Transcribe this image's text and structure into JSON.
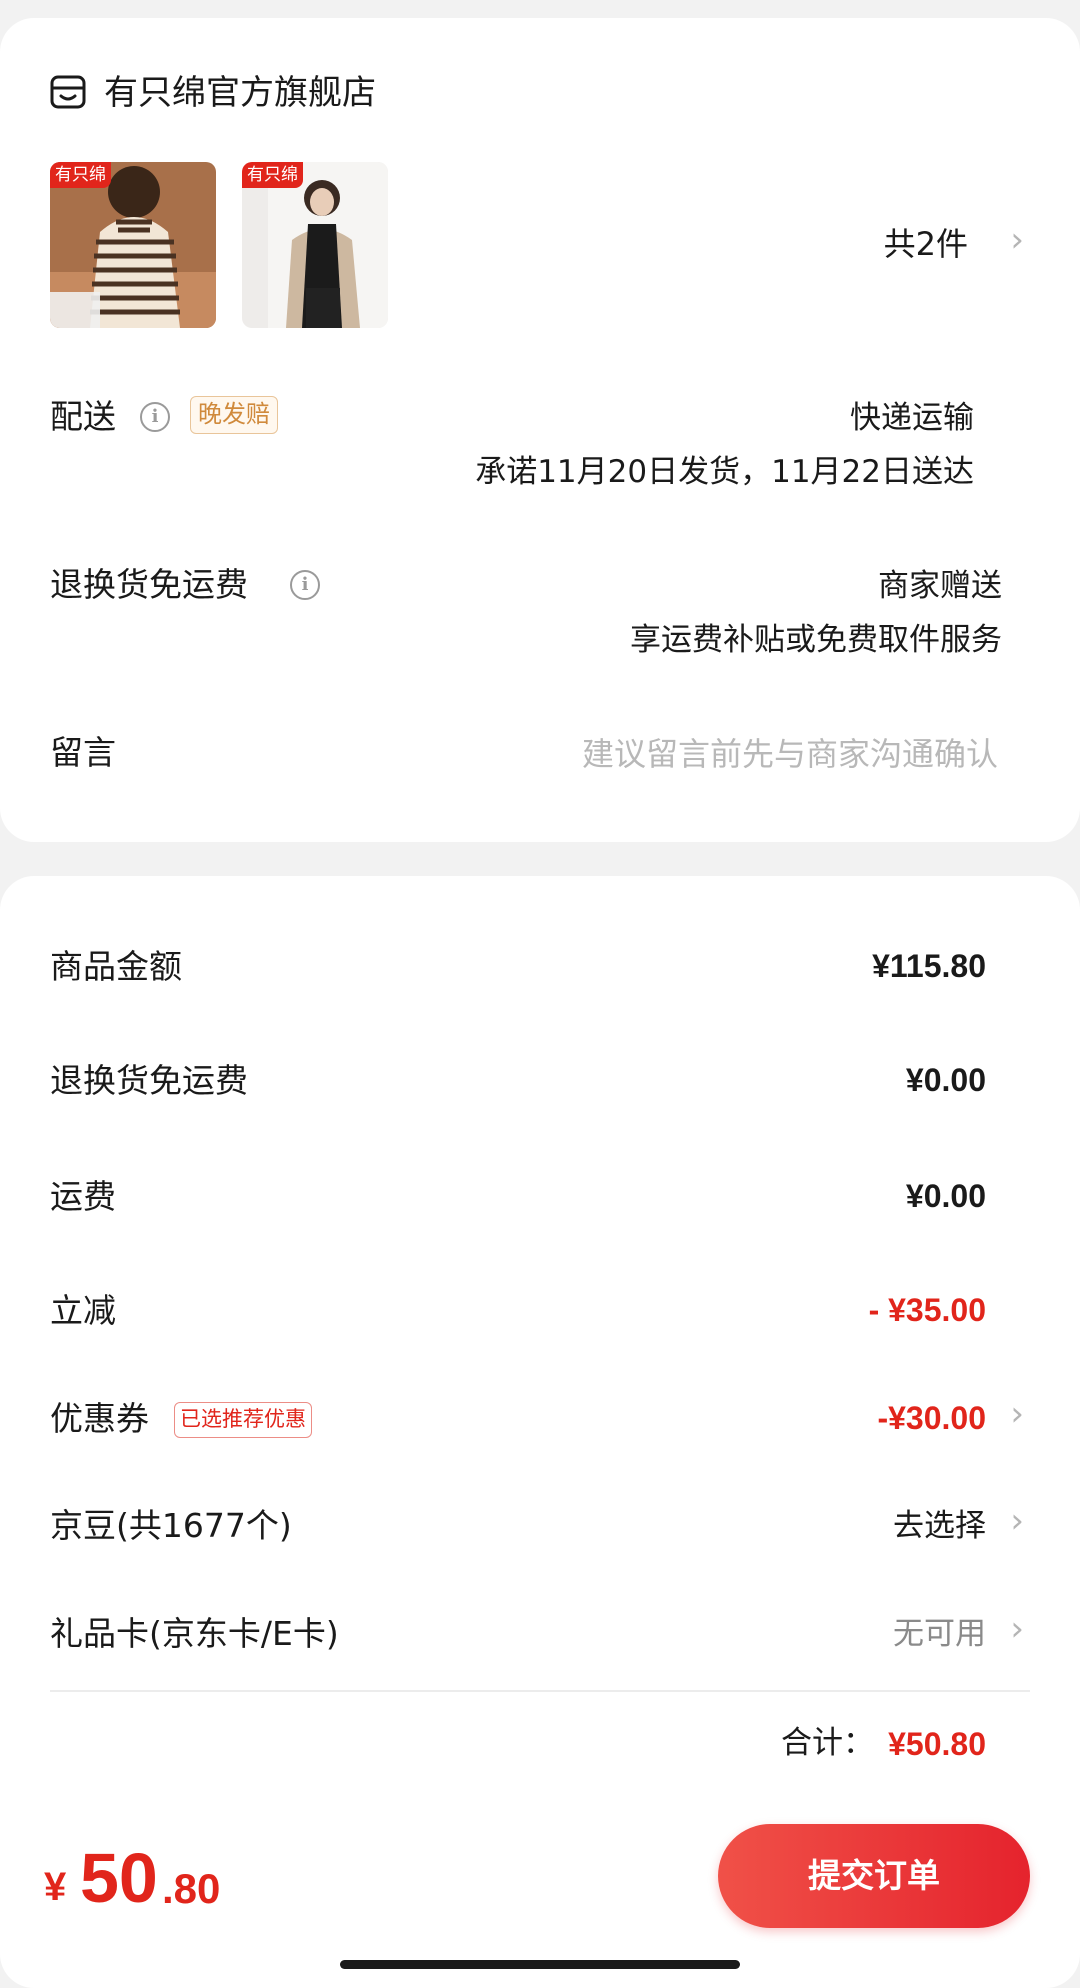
{
  "store": {
    "name": "有只绵官方旗舰店",
    "icon": "store-icon"
  },
  "items": {
    "thumbnail_tags": [
      "有只绵",
      "有只绵"
    ],
    "count_text": "共2件"
  },
  "delivery": {
    "label": "配送",
    "badge": "晚发赔",
    "method": "快递运输",
    "promise": "承诺11月20日发货，11月22日送达"
  },
  "return_shipping": {
    "label": "退换货免运费",
    "value": "商家赠送",
    "desc": "享运费补贴或免费取件服务"
  },
  "message": {
    "label": "留言",
    "placeholder": "建议留言前先与商家沟通确认"
  },
  "summary": {
    "goods_amount": {
      "label": "商品金额",
      "value": "¥115.80"
    },
    "return_fee": {
      "label": "退换货免运费",
      "value": "¥0.00"
    },
    "shipping": {
      "label": "运费",
      "value": "¥0.00"
    },
    "instant_discount": {
      "label": "立减",
      "value": "- ¥35.00"
    },
    "coupon": {
      "label": "优惠券",
      "badge": "已选推荐优惠",
      "value": "-¥30.00"
    },
    "jd_beans": {
      "label": "京豆(共1677个)",
      "value": "去选择"
    },
    "gift_card": {
      "label": "礼品卡(京东卡/E卡)",
      "value": "无可用"
    },
    "total_label": "合计：",
    "total_value": "¥50.80"
  },
  "footer": {
    "currency": "¥",
    "amount_int": "50",
    "amount_dec": ".80",
    "submit_label": "提交订单"
  },
  "colors": {
    "accent_red": "#e1251b",
    "badge_orange": "#d08a3c"
  }
}
